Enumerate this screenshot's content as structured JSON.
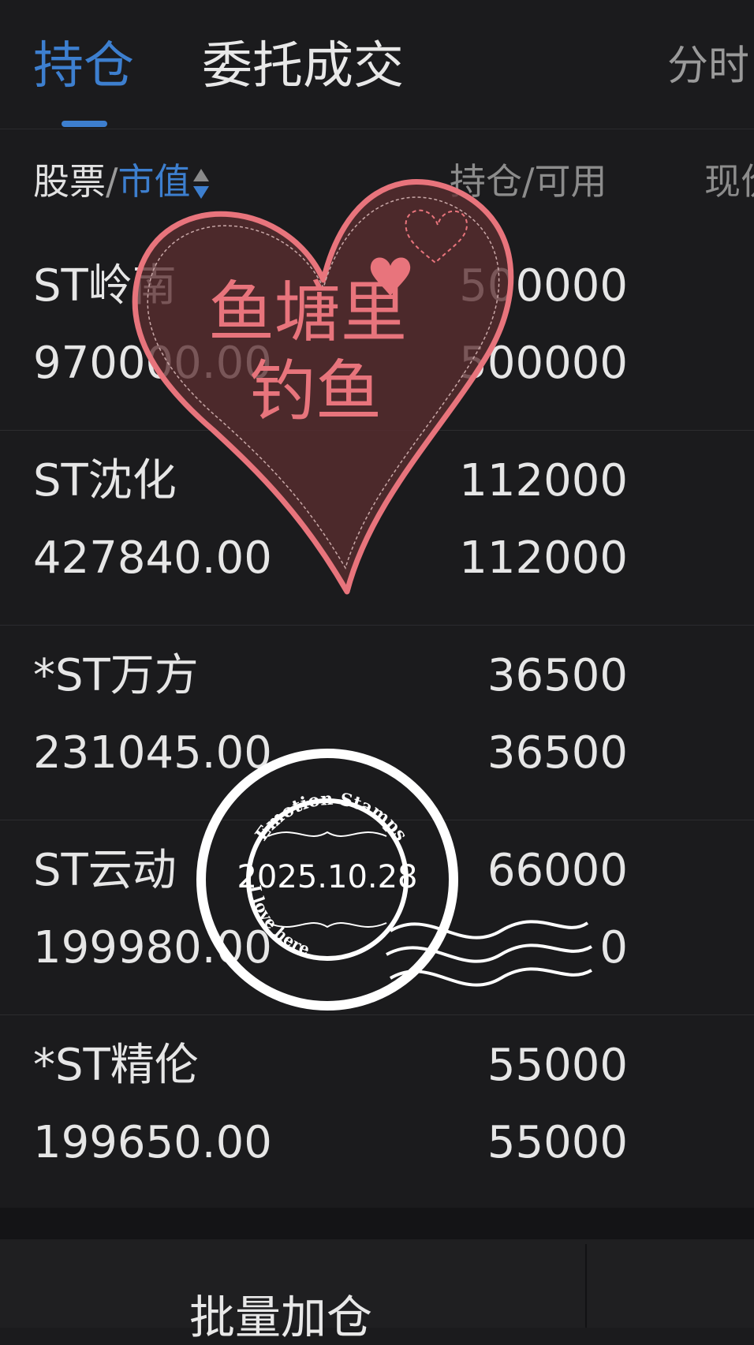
{
  "tabs": [
    {
      "label": "持仓",
      "active": true
    },
    {
      "label": "委托成交",
      "active": false
    },
    {
      "label": "分时",
      "active": false
    }
  ],
  "header": {
    "stock": "股票",
    "separator": "/",
    "market_value": "市值",
    "position": "持仓/可用",
    "price": "现价"
  },
  "rows": [
    {
      "name": "ST岭南",
      "market_value": "970000.00",
      "position": "500000",
      "available": "500000"
    },
    {
      "name": "ST沈化",
      "market_value": "427840.00",
      "position": "112000",
      "available": "112000"
    },
    {
      "name": "*ST万方",
      "market_value": "231045.00",
      "position": "36500",
      "available": "36500"
    },
    {
      "name": "ST云动",
      "market_value": "199980.00",
      "position": "66000",
      "available": "0"
    },
    {
      "name": "*ST精伦",
      "market_value": "199650.00",
      "position": "55000",
      "available": "55000"
    }
  ],
  "bottom": {
    "batch_add_label": "批量加仓"
  },
  "stickers": {
    "heart_line1": "鱼塘里",
    "heart_line2": "钓鱼",
    "stamp_top": "Emotion Stamps",
    "stamp_date": "2025.10.28",
    "stamp_bottom": "I love here"
  },
  "colors": {
    "accent": "#3d7fcf",
    "background": "#1b1b1d",
    "heart": "#e8747c"
  }
}
